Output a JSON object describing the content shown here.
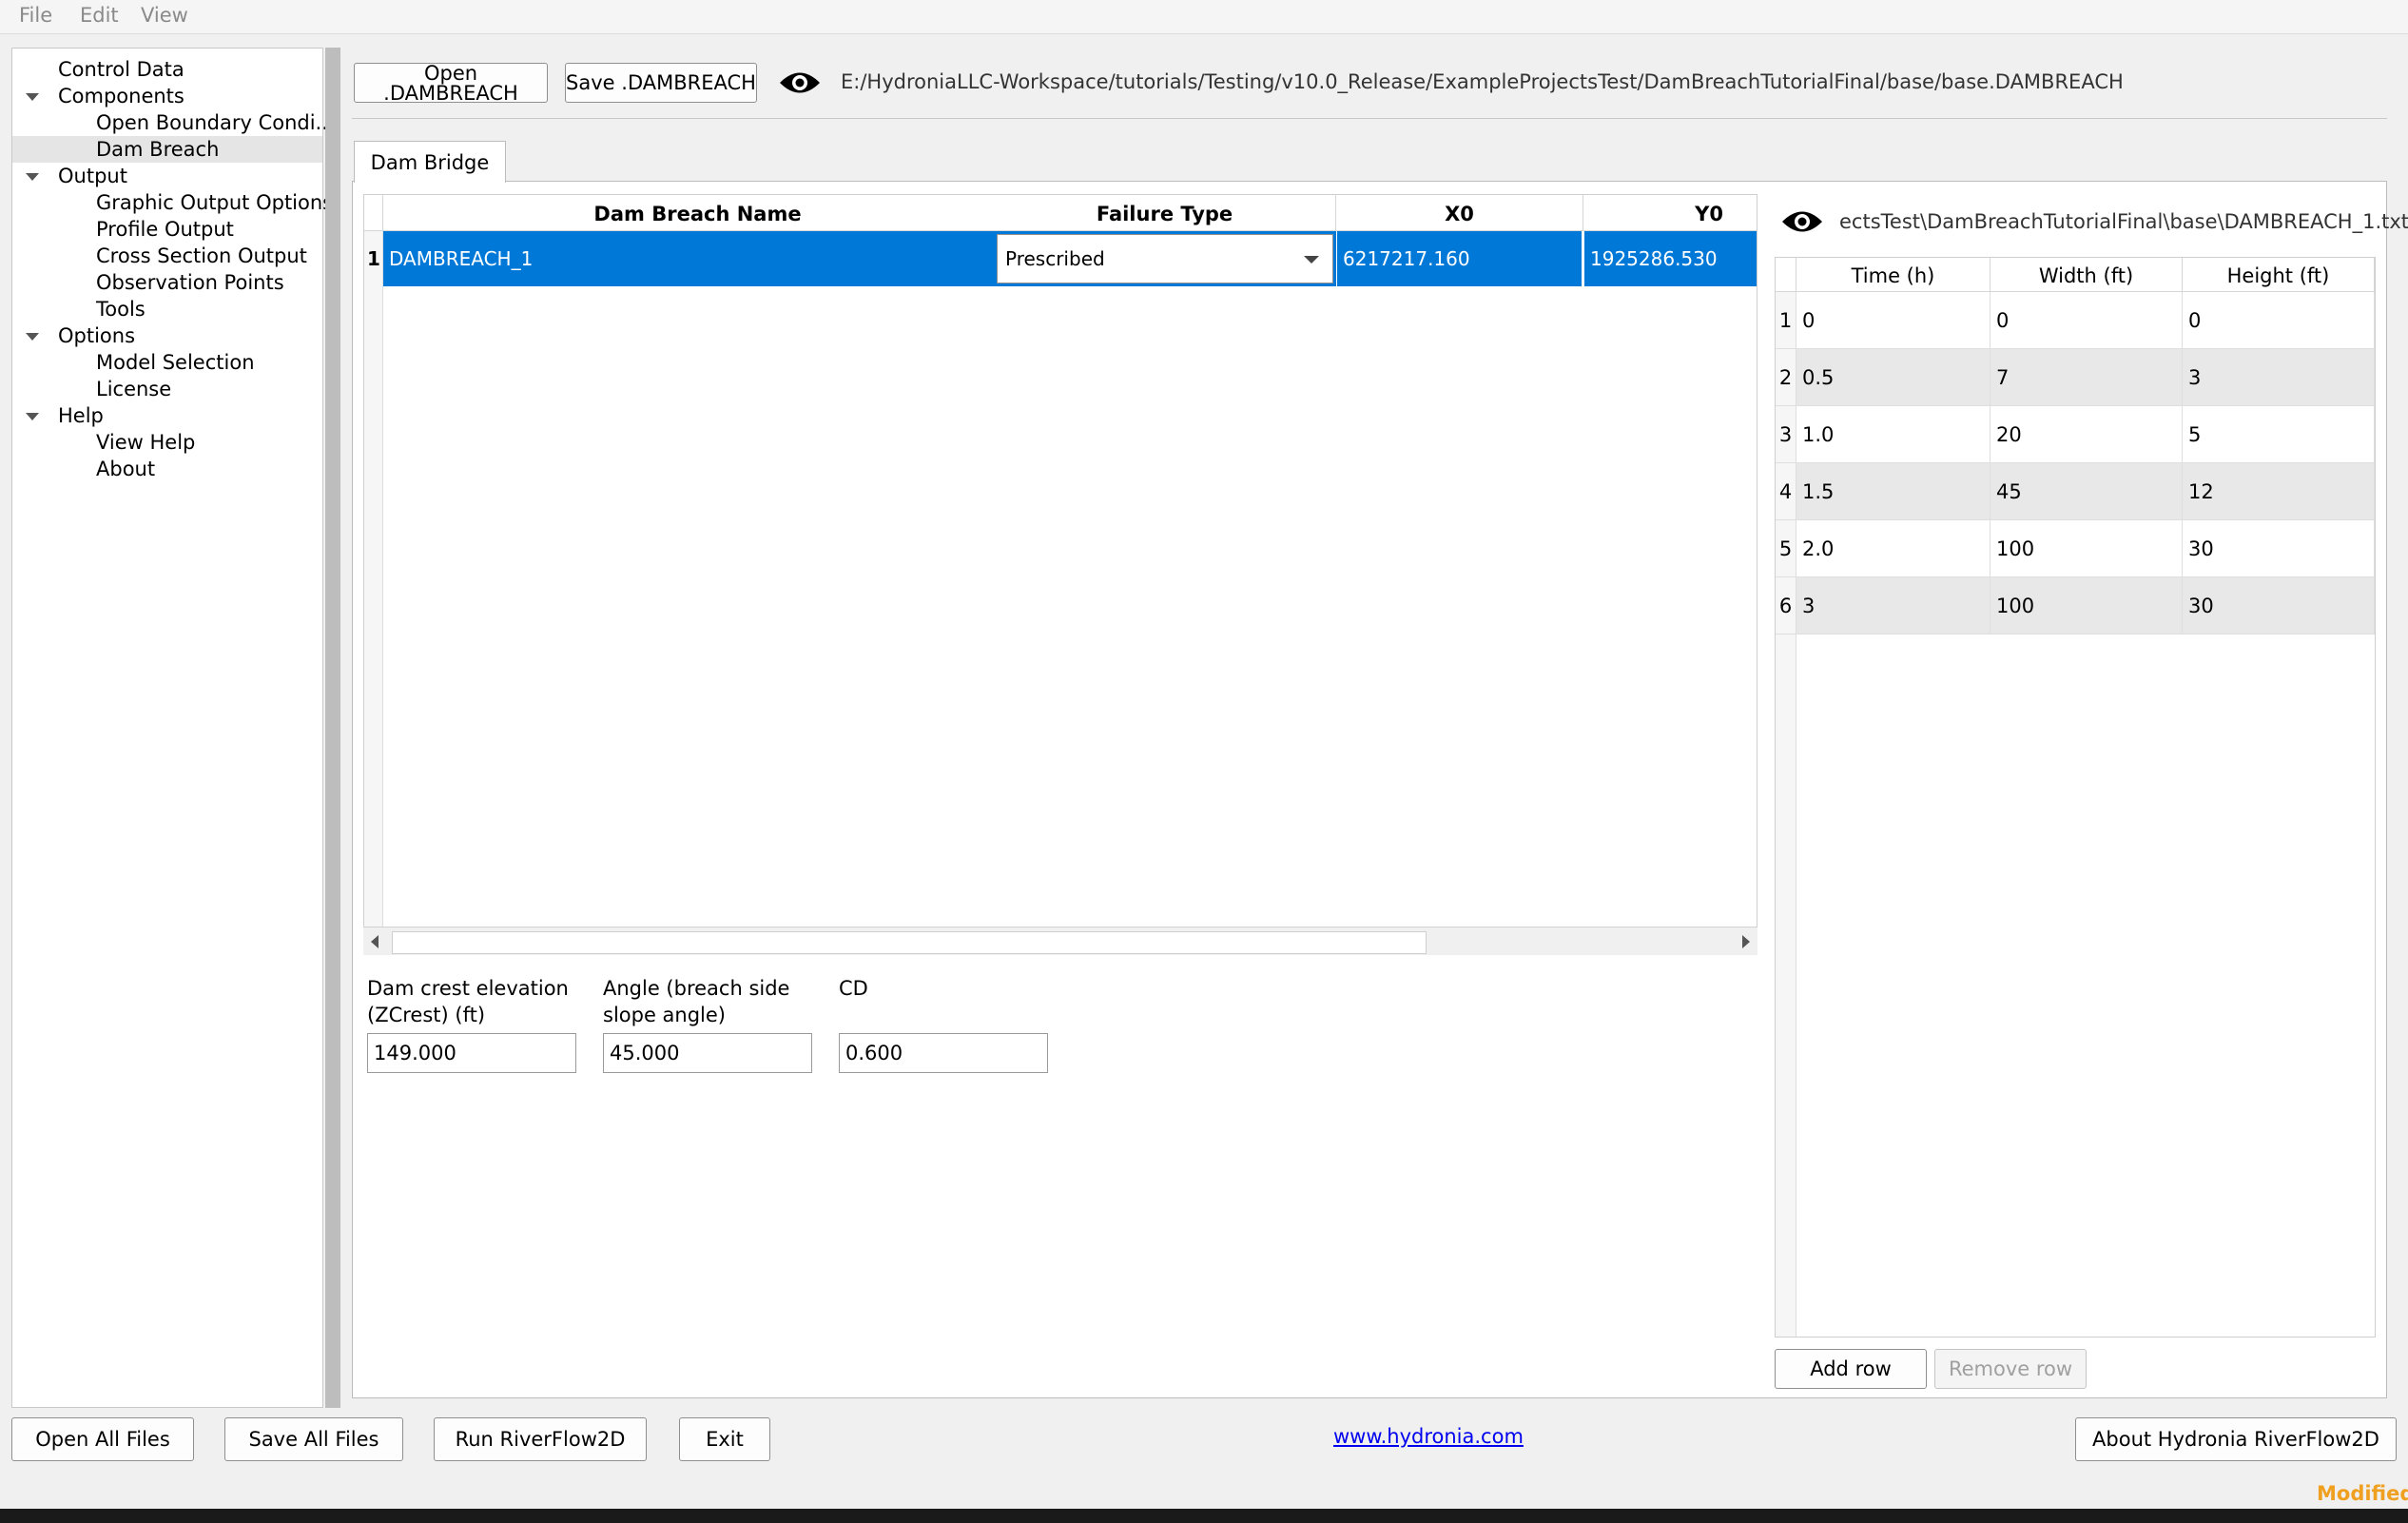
{
  "menu": {
    "file": "File",
    "edit": "Edit",
    "view": "View"
  },
  "tree": {
    "items": [
      {
        "label": "Control Data",
        "level": 0,
        "expander": false
      },
      {
        "label": "Components",
        "level": 0,
        "expander": true
      },
      {
        "label": "Open Boundary Condi...",
        "level": 1,
        "expander": false
      },
      {
        "label": "Dam Breach",
        "level": 1,
        "expander": false,
        "selected": true
      },
      {
        "label": "Output",
        "level": 0,
        "expander": true
      },
      {
        "label": "Graphic Output Options",
        "level": 1,
        "expander": false
      },
      {
        "label": "Profile Output",
        "level": 1,
        "expander": false
      },
      {
        "label": "Cross Section Output",
        "level": 1,
        "expander": false
      },
      {
        "label": "Observation Points",
        "level": 1,
        "expander": false
      },
      {
        "label": "Tools",
        "level": 1,
        "expander": false
      },
      {
        "label": "Options",
        "level": 0,
        "expander": true
      },
      {
        "label": "Model Selection",
        "level": 1,
        "expander": false
      },
      {
        "label": "License",
        "level": 1,
        "expander": false
      },
      {
        "label": "Help",
        "level": 0,
        "expander": true
      },
      {
        "label": "View Help",
        "level": 1,
        "expander": false
      },
      {
        "label": "About",
        "level": 1,
        "expander": false
      }
    ]
  },
  "toolbar": {
    "open_label": "Open .DAMBREACH",
    "save_label": "Save .DAMBREACH",
    "file_path": "E:/HydroniaLLC-Workspace/tutorials/Testing/v10.0_Release/ExampleProjectsTest/DamBreachTutorialFinal/base/base.DAMBREACH"
  },
  "tabs": [
    {
      "label": "Dam Bridge",
      "active": true
    }
  ],
  "breach_table": {
    "columns": [
      "Dam Breach Name",
      "Failure Type",
      "X0",
      "Y0"
    ],
    "rows": [
      {
        "num": "1",
        "name": "DAMBREACH_1",
        "failure_type": "Prescribed",
        "x0": "6217217.160",
        "y0": "1925286.530"
      }
    ]
  },
  "params": {
    "zcrest_label_line1": "Dam crest elevation",
    "zcrest_label_line2": "(ZCrest) (ft)",
    "zcrest_value": "149.000",
    "angle_label_line1": "Angle (breach side",
    "angle_label_line2": "slope angle)",
    "angle_value": "45.000",
    "cd_label": "CD",
    "cd_value": "0.600"
  },
  "timeseries": {
    "file_path": "ectsTest\\DamBreachTutorialFinal\\base\\DAMBREACH_1.txt",
    "columns": [
      "Time (h)",
      "Width (ft)",
      "Height (ft)"
    ],
    "rows": [
      {
        "num": "1",
        "time": "0",
        "width": "0",
        "height": "0"
      },
      {
        "num": "2",
        "time": "0.5",
        "width": "7",
        "height": "3"
      },
      {
        "num": "3",
        "time": "1.0",
        "width": "20",
        "height": "5"
      },
      {
        "num": "4",
        "time": "1.5",
        "width": "45",
        "height": "12"
      },
      {
        "num": "5",
        "time": "2.0",
        "width": "100",
        "height": "30"
      },
      {
        "num": "6",
        "time": "3",
        "width": "100",
        "height": "30"
      }
    ],
    "add_row_label": "Add row",
    "remove_row_label": "Remove row"
  },
  "footer": {
    "open_all": "Open All Files",
    "save_all": "Save All Files",
    "run": "Run RiverFlow2D",
    "exit": "Exit",
    "website": "www.hydronia.com",
    "about": "About Hydronia RiverFlow2D",
    "status": "Modified"
  },
  "colors": {
    "selection_blue": "#0078d7",
    "link_blue": "#0000ee",
    "modified_orange": "#f0a020"
  }
}
